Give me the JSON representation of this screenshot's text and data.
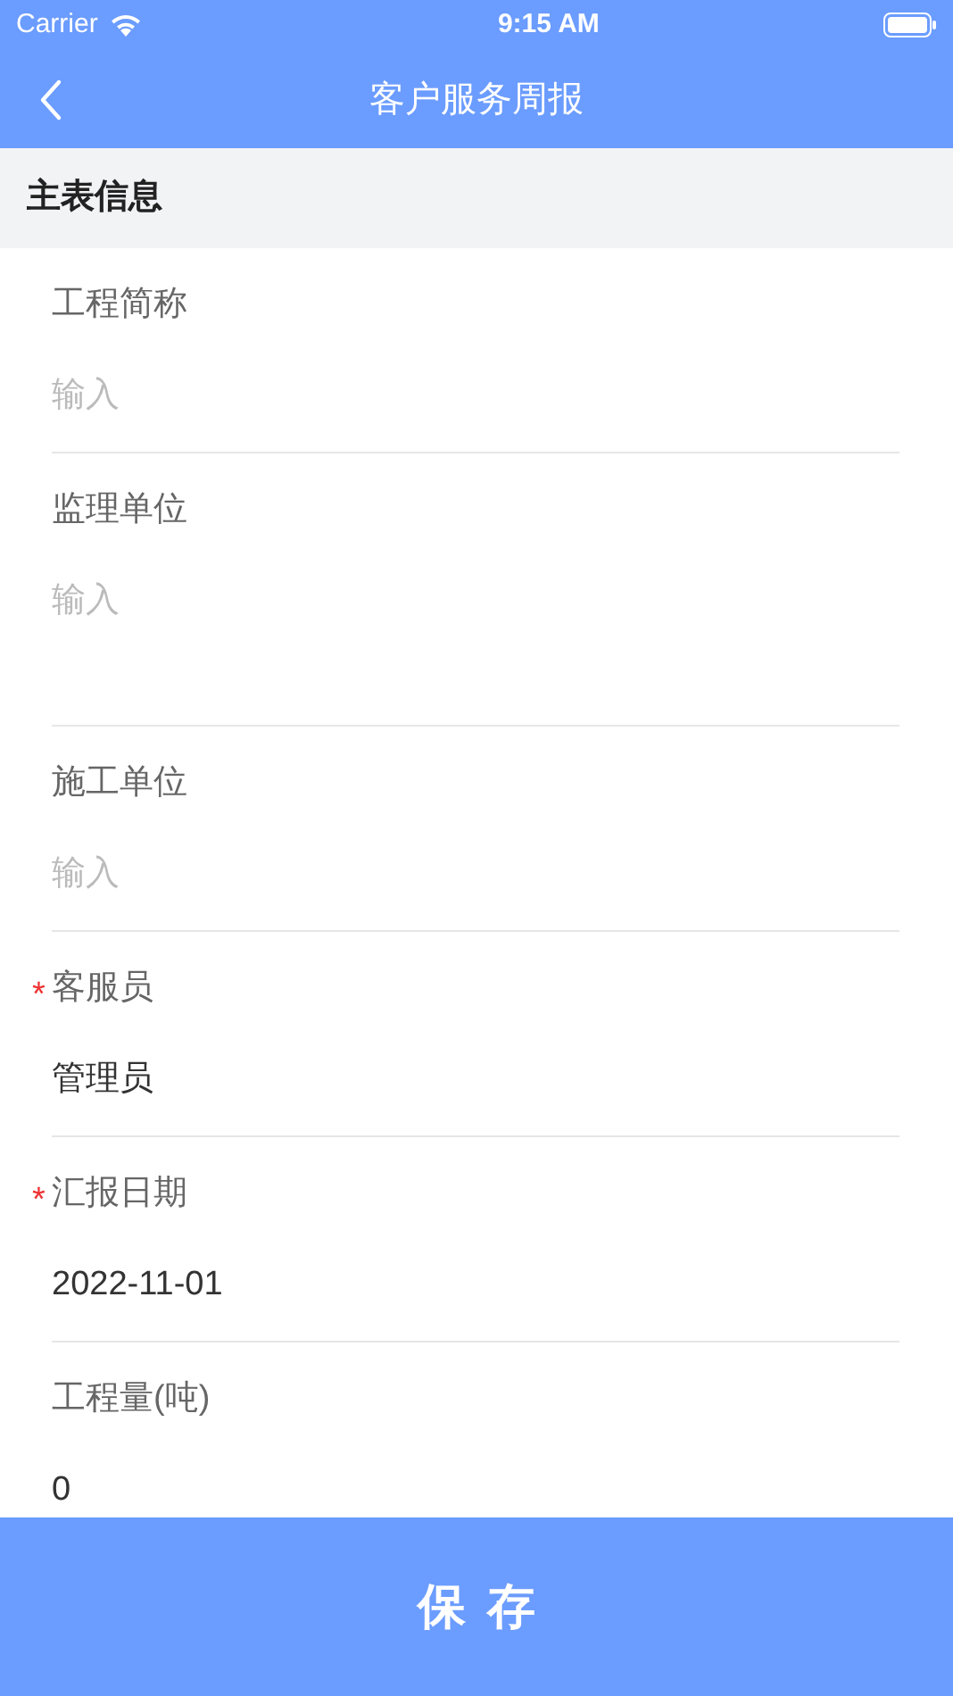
{
  "status_bar": {
    "carrier": "Carrier",
    "time": "9:15 AM"
  },
  "nav_bar": {
    "title": "客户服务周报"
  },
  "section": {
    "title": "主表信息"
  },
  "fields": [
    {
      "kind": "input",
      "label": "工程简称",
      "placeholder": "输入"
    },
    {
      "kind": "textarea",
      "label": "监理单位",
      "placeholder": "输入"
    },
    {
      "kind": "input",
      "label": "施工单位",
      "placeholder": "输入"
    },
    {
      "kind": "input",
      "label": "客服员",
      "mark": "*",
      "value": "管理员"
    },
    {
      "kind": "input",
      "label": "汇报日期",
      "mark": "*",
      "value": "2022-11-01"
    },
    {
      "kind": "input",
      "label": "工程量(吨)",
      "value": "0"
    }
  ],
  "save_button": {
    "label": "保存"
  }
}
